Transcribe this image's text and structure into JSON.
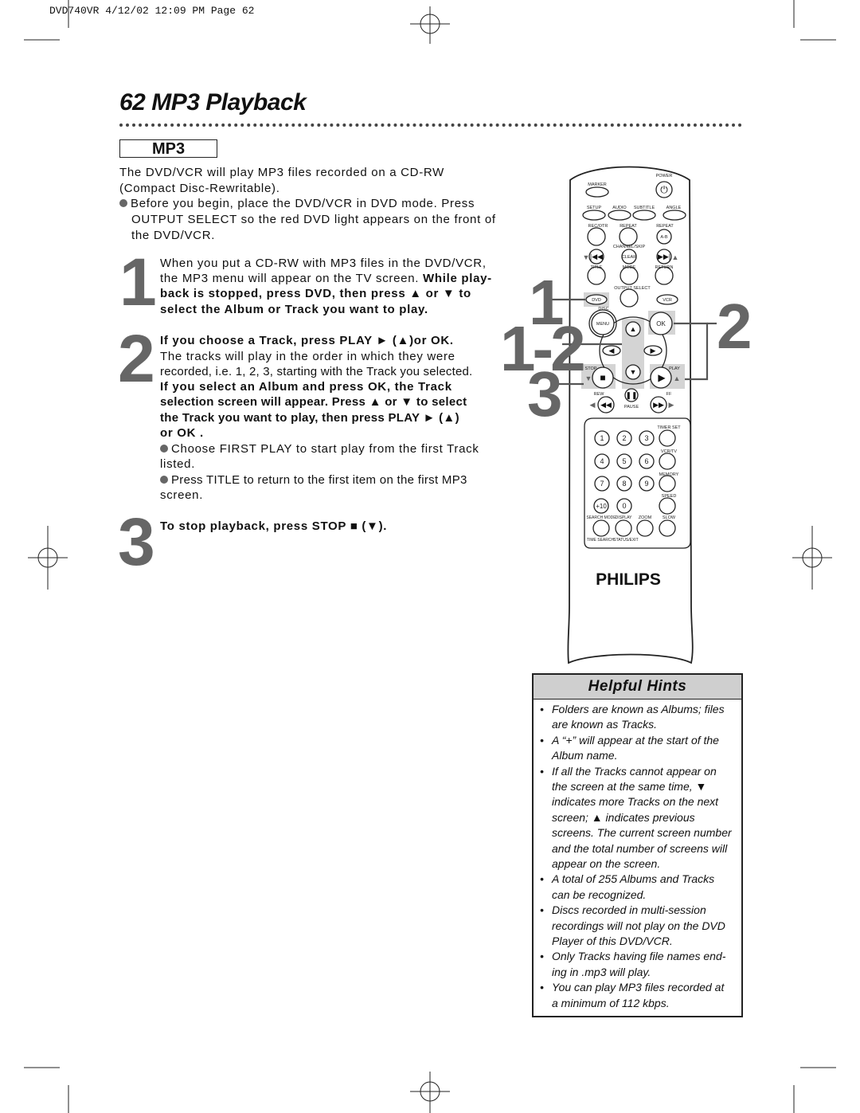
{
  "header": {
    "text": "DVD740VR  4/12/02  12:09 PM  Page 62"
  },
  "page_title": "62  MP3 Playback",
  "section_label": "MP3",
  "intro": {
    "lines": [
      "The DVD/VCR will play MP3 files recorded on a CD-RW",
      "(Compact Disc-Rewritable)."
    ],
    "bullet_lines": [
      "Before you begin, place the DVD/VCR in DVD mode. Press",
      "OUTPUT SELECT so the red DVD light appears on the front of",
      "the DVD/VCR."
    ]
  },
  "step1": {
    "number": "1",
    "l1": "When you put a CD-RW with MP3 files in the DVD/VCR,",
    "l2a": "the MP3 menu will appear on the TV screen. ",
    "l2b": "While play-",
    "l3": "back is stopped, press DVD, then press ▲ or ▼ to",
    "l4": "select the Album or Track you want to play."
  },
  "step2": {
    "number": "2",
    "l1": "If you choose a Track, press PLAY ► (▲)or OK.",
    "l2": "The tracks will play in the order in which they were",
    "l3": "recorded, i.e. 1, 2, 3, starting with the Track you selected.",
    "l4": "If you select an Album and press OK, the Track",
    "l5": "selection screen will appear. Press ▲ or ▼ to select",
    "l6": "the Track you want to play, then press PLAY ► (▲)",
    "l7": "or OK .",
    "b1a": "Choose FIRST PLAY to start play from the first Track",
    "b1b": "listed.",
    "b2a": "Press TITLE to return to the first item on the first MP3",
    "b2b": "screen."
  },
  "step3": {
    "number": "3",
    "l1": "To stop playback, press STOP ■ (▼)."
  },
  "callouts": {
    "c1": "1",
    "c12": "1-2",
    "c3": "3",
    "c2": "2"
  },
  "remote": {
    "brand": "PHILIPS",
    "labels": {
      "power": "POWER",
      "marker": "MARKER",
      "setup": "SETUP",
      "audio": "AUDIO",
      "subtitle": "SUBTITLE",
      "angle": "ANGLE",
      "recotr": "REC/OTR",
      "repeat": "REPEAT",
      "repeat_ab": "REPEAT",
      "ab": "A-B",
      "channel_skip": "CHANNEL/SKIP",
      "clear": "CLEAR",
      "title": "TITLE",
      "mode": "MODE",
      "return": "RETURN",
      "output_select": "OUTPUT SELECT",
      "dvd": "DVD",
      "vcr": "VCR",
      "disc": "DISC",
      "menu": "MENU",
      "ok": "OK",
      "stop": "STOP",
      "play": "PLAY",
      "rew": "REW",
      "ff": "FF",
      "pause": "PAUSE",
      "timer_set": "TIMER SET",
      "vcr_tv": "VCR/TV",
      "memory": "MEMORY",
      "speed": "SPEED",
      "search_mode": "SEARCH MODE",
      "display": "DISPLAY",
      "zoom": "ZOOM",
      "slow": "SLOW",
      "time_search": "TIME SEARCH",
      "status_exit": "STATUS/EXIT"
    },
    "digits": [
      "1",
      "2",
      "3",
      "4",
      "5",
      "6",
      "7",
      "8",
      "9",
      "+10",
      "0"
    ],
    "highlight_color": "#d4d4d4"
  },
  "hints": {
    "title": "Helpful Hints",
    "lines": [
      {
        "bullet": true,
        "text": "Folders are known as Albums; files"
      },
      {
        "bullet": false,
        "text": "are known as Tracks."
      },
      {
        "bullet": true,
        "text": "A “+” will appear at the start of the"
      },
      {
        "bullet": false,
        "text": "Album name."
      },
      {
        "bullet": true,
        "text": "If all the Tracks cannot appear on"
      },
      {
        "bullet": false,
        "text": "the screen at the same time, ▼"
      },
      {
        "bullet": false,
        "text": "indicates more Tracks on the next"
      },
      {
        "bullet": false,
        "text": "screen; ▲ indicates previous"
      },
      {
        "bullet": false,
        "text": "screens. The current screen number"
      },
      {
        "bullet": false,
        "text": "and the total number of screens will"
      },
      {
        "bullet": false,
        "text": "appear on the screen."
      },
      {
        "bullet": true,
        "text": "A total of 255 Albums and Tracks"
      },
      {
        "bullet": false,
        "text": "can be recognized."
      },
      {
        "bullet": true,
        "text": "Discs recorded in multi-session"
      },
      {
        "bullet": false,
        "text": "recordings will not play on the DVD"
      },
      {
        "bullet": false,
        "text": "Player of this DVD/VCR."
      },
      {
        "bullet": true,
        "text": "Only Tracks having file names end-"
      },
      {
        "bullet": false,
        "text": "ing in .mp3 will play."
      },
      {
        "bullet": true,
        "text": "You can play MP3 files recorded at"
      },
      {
        "bullet": false,
        "text": "a minimum of 112 kbps."
      }
    ]
  }
}
